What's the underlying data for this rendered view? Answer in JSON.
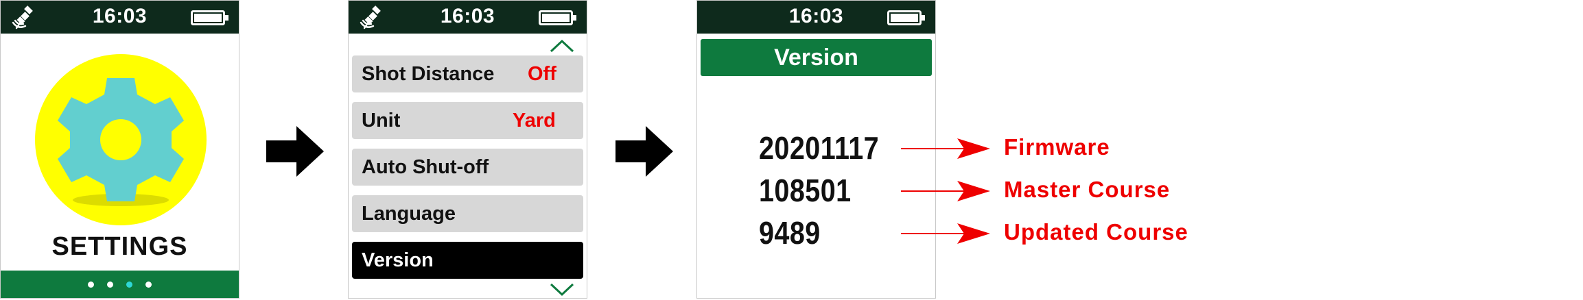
{
  "status_bar": {
    "time": "16:03"
  },
  "screen_settings": {
    "title": "SETTINGS",
    "page_dots": 4,
    "active_dot": 3
  },
  "screen_menu": {
    "items": [
      {
        "label": "Shot Distance",
        "value": "Off",
        "selected": false
      },
      {
        "label": "Unit",
        "value": "Yard",
        "selected": false
      },
      {
        "label": "Auto Shut-off",
        "value": "",
        "selected": false
      },
      {
        "label": "Language",
        "value": "",
        "selected": false
      },
      {
        "label": "Version",
        "value": "",
        "selected": true
      }
    ]
  },
  "screen_version": {
    "header": "Version",
    "rows": [
      {
        "number": "20201117",
        "annotation": "Firmware"
      },
      {
        "number": "108501",
        "annotation": "Master Course"
      },
      {
        "number": "9489",
        "annotation": "Updated Course"
      }
    ]
  },
  "icons": {
    "status_left": "satellite-icon",
    "status_right": "battery-icon",
    "settings": "gear-icon",
    "flow": "right-arrow-icon",
    "scroll_up": "chevron-up-icon",
    "scroll_down": "chevron-down-icon"
  },
  "colors": {
    "status_bar": "#0e2a1c",
    "accent_green": "#0e7a3e",
    "gear_circle": "#ffff00",
    "gear": "#62cfcf",
    "menu_item": "#d7d7d7",
    "menu_selected": "#000000",
    "value_red": "#ee0000",
    "active_dot": "#2fd6d6"
  }
}
